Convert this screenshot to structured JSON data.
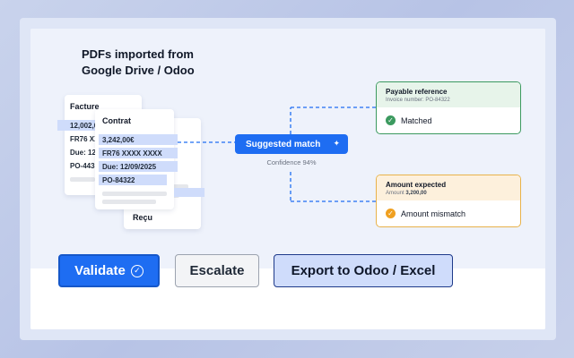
{
  "headline": {
    "line1": "PDFs imported from",
    "line2": "Google Drive / Odoo"
  },
  "documents": {
    "facture": {
      "title": "Facture",
      "lines": [
        "12,002,0",
        "FR76 XXX",
        "Due: 12/",
        "PO-443"
      ]
    },
    "contrat": {
      "title": "Contrat",
      "lines": [
        "3,242,00€",
        "FR76 XXXX XXXX",
        "Due: 12/09/2025",
        "PO-84322"
      ]
    },
    "recu": {
      "title": "Reçu"
    }
  },
  "match": {
    "label": "Suggested match",
    "confidence": "Confidence 94%"
  },
  "payable": {
    "title": "Payable reference",
    "subtitle_label": "Invoice number",
    "subtitle_value": "PO-84322",
    "status": "Matched",
    "color": "#3c9a5f"
  },
  "amount": {
    "title": "Amount expected",
    "subtitle_label": "Amount",
    "subtitle_value": "3,200,00",
    "status": "Amount mismatch",
    "color": "#f0a020"
  },
  "actions": {
    "validate": "Validate",
    "escalate": "Escalate",
    "export": "Export to Odoo / Excel"
  },
  "colors": {
    "accent": "#1e6df2",
    "matched": "#3c9a5f",
    "mismatch": "#f0a020"
  }
}
